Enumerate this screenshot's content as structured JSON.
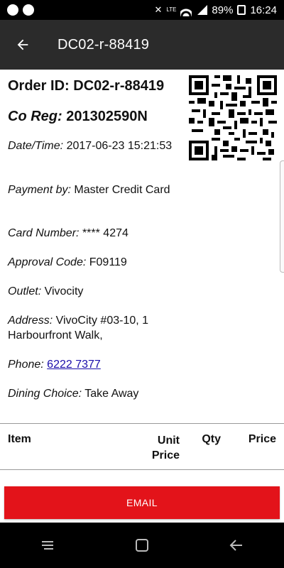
{
  "status_bar": {
    "battery": "89%",
    "time": "16:24",
    "network_label": "LTE",
    "icons": [
      "whatsapp-icon",
      "app-notification-icon",
      "mute-icon",
      "volte-lte-icon",
      "wifi-icon",
      "signal-icon",
      "battery-icon"
    ]
  },
  "app_bar": {
    "title": "DC02-r-88419",
    "back_icon": "arrow-left-icon"
  },
  "order": {
    "order_id_label": "Order ID:",
    "order_id_value": "DC02-r-88419",
    "co_reg_label": "Co Reg:",
    "co_reg_value": "201302590N",
    "fields": {
      "datetime": {
        "label": "Date/Time:",
        "value": "2017-06-23 15:21:53"
      },
      "payment": {
        "label": "Payment by:",
        "value": "Master Credit Card"
      },
      "card_number": {
        "label": "Card Number:",
        "value": "**** 4274"
      },
      "approval": {
        "label": "Approval Code:",
        "value": "F09119"
      },
      "outlet": {
        "label": "Outlet:",
        "value": "Vivocity"
      },
      "address": {
        "label": "Address:",
        "value": "VivoCity #03-10, 1 Harbourfront Walk,"
      },
      "phone": {
        "label": "Phone:",
        "value": "6222 7377"
      },
      "dining": {
        "label": "Dining Choice:",
        "value": "Take Away"
      }
    },
    "qr_icon": "qr-code"
  },
  "table": {
    "headers": {
      "item": "Item",
      "unit_price_line1": "Unit",
      "unit_price_line2": "Price",
      "qty": "Qty",
      "price": "Price"
    }
  },
  "actions": {
    "email_label": "EMAIL"
  },
  "nav": {
    "icons": [
      "recent-apps-icon",
      "home-icon",
      "back-icon"
    ]
  },
  "colors": {
    "app_bar": "#2b2b2b",
    "accent_button": "#e3131a",
    "link": "#1a0dab"
  }
}
